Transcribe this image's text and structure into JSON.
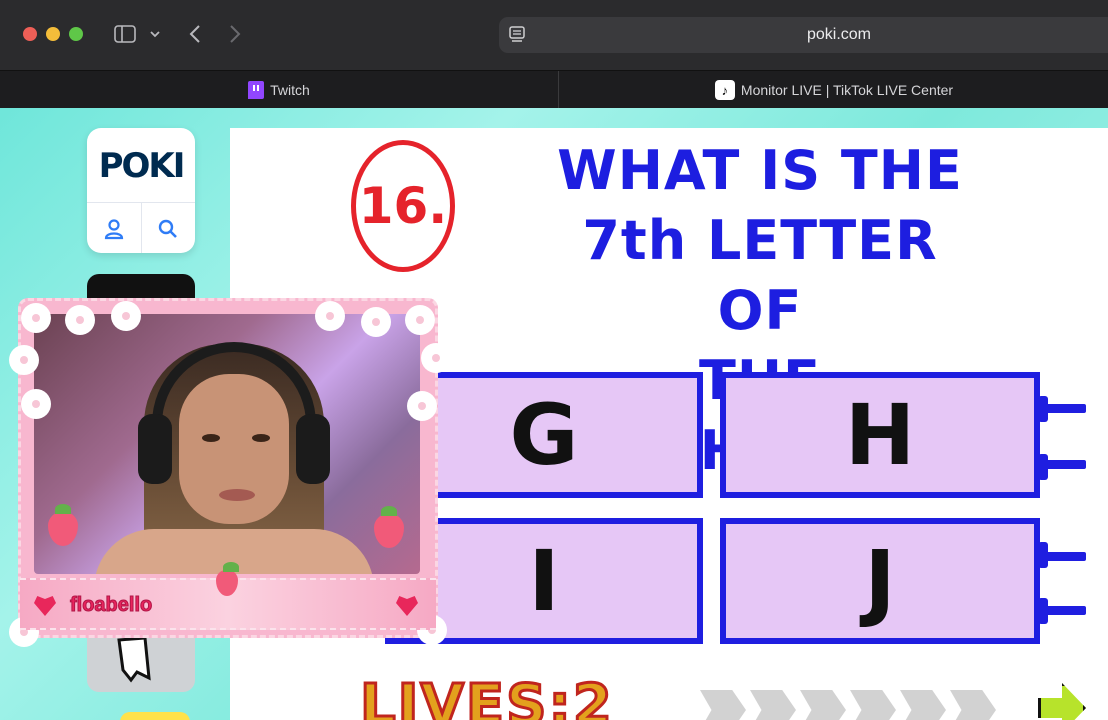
{
  "browser": {
    "url": "poki.com",
    "tabs": [
      {
        "label": "Twitch",
        "icon": "twitch-icon"
      },
      {
        "label": "Monitor LIVE | TikTok LIVE Center",
        "icon": "tiktok-icon"
      }
    ]
  },
  "sidebar": {
    "logo": "POKI"
  },
  "game": {
    "question_number": "16.",
    "question_lines": [
      "WHAT IS THE",
      "7th LETTER OF",
      "THE ALPHABET?"
    ],
    "answers": [
      "G",
      "H",
      "I",
      "J"
    ],
    "lives_label": "LIVES:2"
  },
  "webcam": {
    "username": "floabello"
  },
  "colors": {
    "question_blue": "#1f1ee0",
    "answer_fill": "#e6c7f6",
    "circle_red": "#e5232b",
    "page_teal": "#7ee9dc"
  }
}
